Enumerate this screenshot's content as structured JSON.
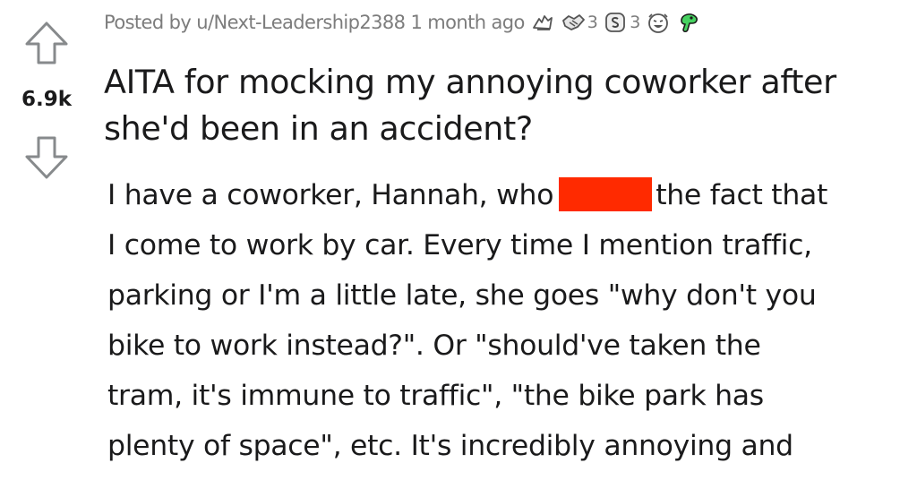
{
  "vote": {
    "score": "6.9k",
    "upvote_icon": "upvote-arrow-icon",
    "downvote_icon": "downvote-arrow-icon"
  },
  "meta": {
    "posted_by": "Posted by u/Next-Leadership2388",
    "age": "1 month ago",
    "awards": [
      {
        "icon": "hands-award-icon",
        "count": ""
      },
      {
        "icon": "handshake-award-icon",
        "count": "3"
      },
      {
        "icon": "silver-coin-award-icon",
        "count": "3"
      },
      {
        "icon": "laughing-face-award-icon",
        "count": ""
      },
      {
        "icon": "green-dinosaur-award-icon",
        "count": ""
      }
    ]
  },
  "title_lines": [
    "AITA for mocking my annoying coworker after",
    "she'd been in an accident?"
  ],
  "body": {
    "line1_before": "I have a coworker, Hannah, who",
    "line1_after": "the fact that",
    "lines": [
      "I come to work by car. Every time I mention traffic,",
      "parking or I'm a little late, she goes \"why don't you",
      "bike to work instead?\". Or \"should've taken the",
      "tram, it's immune to traffic\", \"the bike park has",
      "plenty of space\", etc. It's incredibly annoying and"
    ],
    "redaction_color": "#ff2a00"
  },
  "colors": {
    "text": "#1a1a1b",
    "meta": "#7c7c7c",
    "arrow": "#878a8c"
  }
}
